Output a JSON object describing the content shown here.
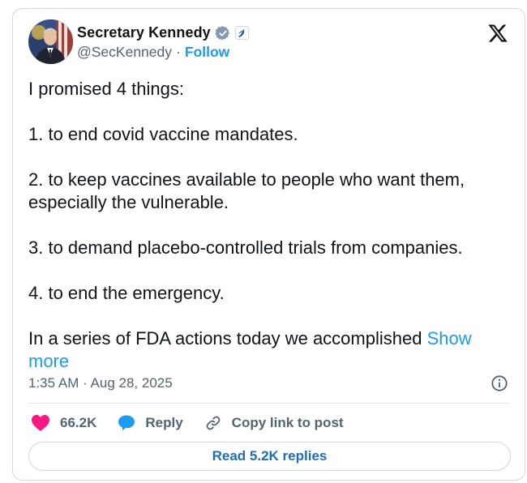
{
  "author": {
    "name": "Secretary Kennedy",
    "handle": "@SecKennedy",
    "separator": "·",
    "follow_label": "Follow"
  },
  "tweet": {
    "paragraphs": [
      "I promised 4 things:",
      "1. to end covid vaccine mandates.",
      "2. to keep vaccines available to people who want them, especially the vulnerable.",
      "3. to demand placebo-controlled trials from companies.",
      "4. to end the emergency."
    ],
    "last_line": "In a series of FDA actions today we accomplished",
    "show_more": "Show more",
    "timestamp": "1:35 AM · Aug 28, 2025"
  },
  "actions": {
    "like_count": "66.2K",
    "reply_label": "Reply",
    "copy_label": "Copy link to post"
  },
  "footer": {
    "read_replies": "Read 5.2K replies"
  },
  "colors": {
    "accent": "#1d9bf0",
    "like": "#f91880",
    "reply_icon": "#1d9bf0",
    "secondary_text": "#536471"
  },
  "icons": {
    "verified": "verified-gray-badge-icon",
    "affiliation": "hhs-eagle-icon",
    "brand": "x-logo-icon",
    "info": "info-icon",
    "like": "heart-icon",
    "reply": "speech-bubble-icon",
    "copy": "link-icon"
  }
}
